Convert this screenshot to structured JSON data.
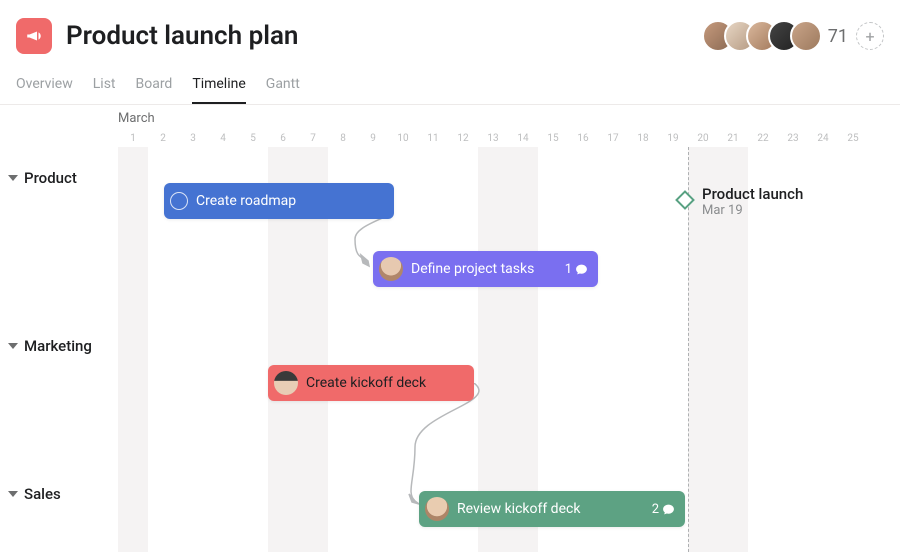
{
  "header": {
    "title": "Product launch plan",
    "more_count": "71"
  },
  "tabs": {
    "overview": "Overview",
    "list": "List",
    "board": "Board",
    "timeline": "Timeline",
    "gantt": "Gantt",
    "active": "timeline"
  },
  "timeline": {
    "month": "March",
    "days": [
      "1",
      "2",
      "3",
      "4",
      "5",
      "6",
      "7",
      "8",
      "9",
      "10",
      "11",
      "12",
      "13",
      "14",
      "15",
      "16",
      "17",
      "18",
      "19",
      "20",
      "21",
      "22",
      "23",
      "24",
      "25"
    ]
  },
  "sections": {
    "product": "Product",
    "marketing": "Marketing",
    "sales": "Sales"
  },
  "tasks": {
    "roadmap": {
      "label": "Create roadmap"
    },
    "define": {
      "label": "Define project tasks",
      "comments": "1"
    },
    "kickoff": {
      "label": "Create kickoff deck"
    },
    "review": {
      "label": "Review kickoff deck",
      "comments": "2"
    }
  },
  "milestone": {
    "title": "Product launch",
    "date": "Mar 19"
  }
}
